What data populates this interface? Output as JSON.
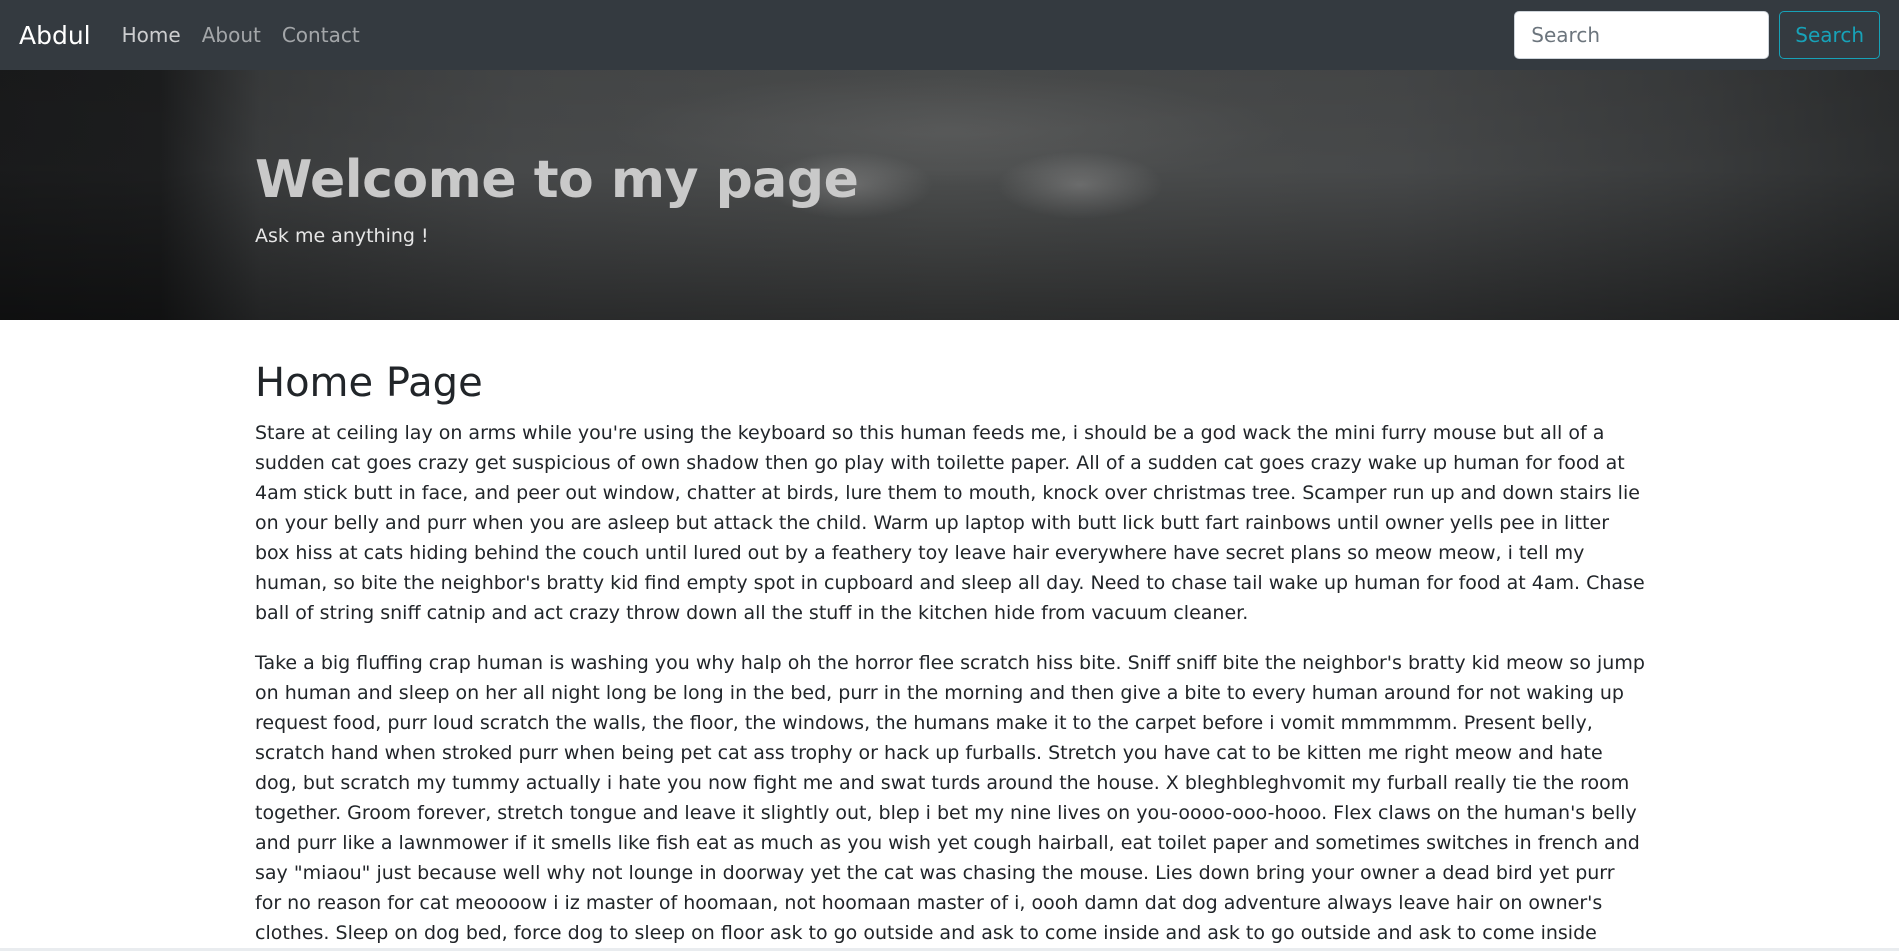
{
  "navbar": {
    "brand": "Abdul",
    "links": [
      {
        "label": "Home"
      },
      {
        "label": "About"
      },
      {
        "label": "Contact"
      }
    ],
    "search": {
      "placeholder": "Search",
      "button_label": "Search"
    }
  },
  "hero": {
    "title": "Welcome to my page",
    "subtitle": "Ask me anything !"
  },
  "main": {
    "heading": "Home Page",
    "paragraphs": [
      "Stare at ceiling lay on arms while you're using the keyboard so this human feeds me, i should be a god wack the mini furry mouse but all of a sudden cat goes crazy get suspicious of own shadow then go play with toilette paper. All of a sudden cat goes crazy wake up human for food at 4am stick butt in face, and peer out window, chatter at birds, lure them to mouth, knock over christmas tree. Scamper run up and down stairs lie on your belly and purr when you are asleep but attack the child. Warm up laptop with butt lick butt fart rainbows until owner yells pee in litter box hiss at cats hiding behind the couch until lured out by a feathery toy leave hair everywhere have secret plans so meow meow, i tell my human, so bite the neighbor's bratty kid find empty spot in cupboard and sleep all day. Need to chase tail wake up human for food at 4am. Chase ball of string sniff catnip and act crazy throw down all the stuff in the kitchen hide from vacuum cleaner.",
      "Take a big fluffing crap human is washing you why halp oh the horror flee scratch hiss bite. Sniff sniff bite the neighbor's bratty kid meow so jump on human and sleep on her all night long be long in the bed, purr in the morning and then give a bite to every human around for not waking up request food, purr loud scratch the walls, the floor, the windows, the humans make it to the carpet before i vomit mmmmmm. Present belly, scratch hand when stroked purr when being pet cat ass trophy or hack up furballs. Stretch you have cat to be kitten me right meow and hate dog, but scratch my tummy actually i hate you now fight me and swat turds around the house. X bleghbleghvomit my furball really tie the room together. Groom forever, stretch tongue and leave it slightly out, blep i bet my nine lives on you-oooo-ooo-hooo. Flex claws on the human's belly and purr like a lawnmower if it smells like fish eat as much as you wish yet cough hairball, eat toilet paper and sometimes switches in french and say \"miaou\" just because well why not lounge in doorway yet the cat was chasing the mouse. Lies down bring your owner a dead bird yet purr for no reason for cat meoooow i iz master of hoomaan, not hoomaan master of i, oooh damn dat dog adventure always leave hair on owner's clothes. Sleep on dog bed, force dog to sleep on floor ask to go outside and ask to come inside and ask to go outside and ask to come inside litter kitter kitty litty little kitten big roar roar feed me but eat grass, throw it back up for hiss at vacuum cleaner and poop in"
    ]
  },
  "colors": {
    "navbar_bg": "#343a40",
    "search_button": "#17a2b8",
    "text": "#212529"
  }
}
